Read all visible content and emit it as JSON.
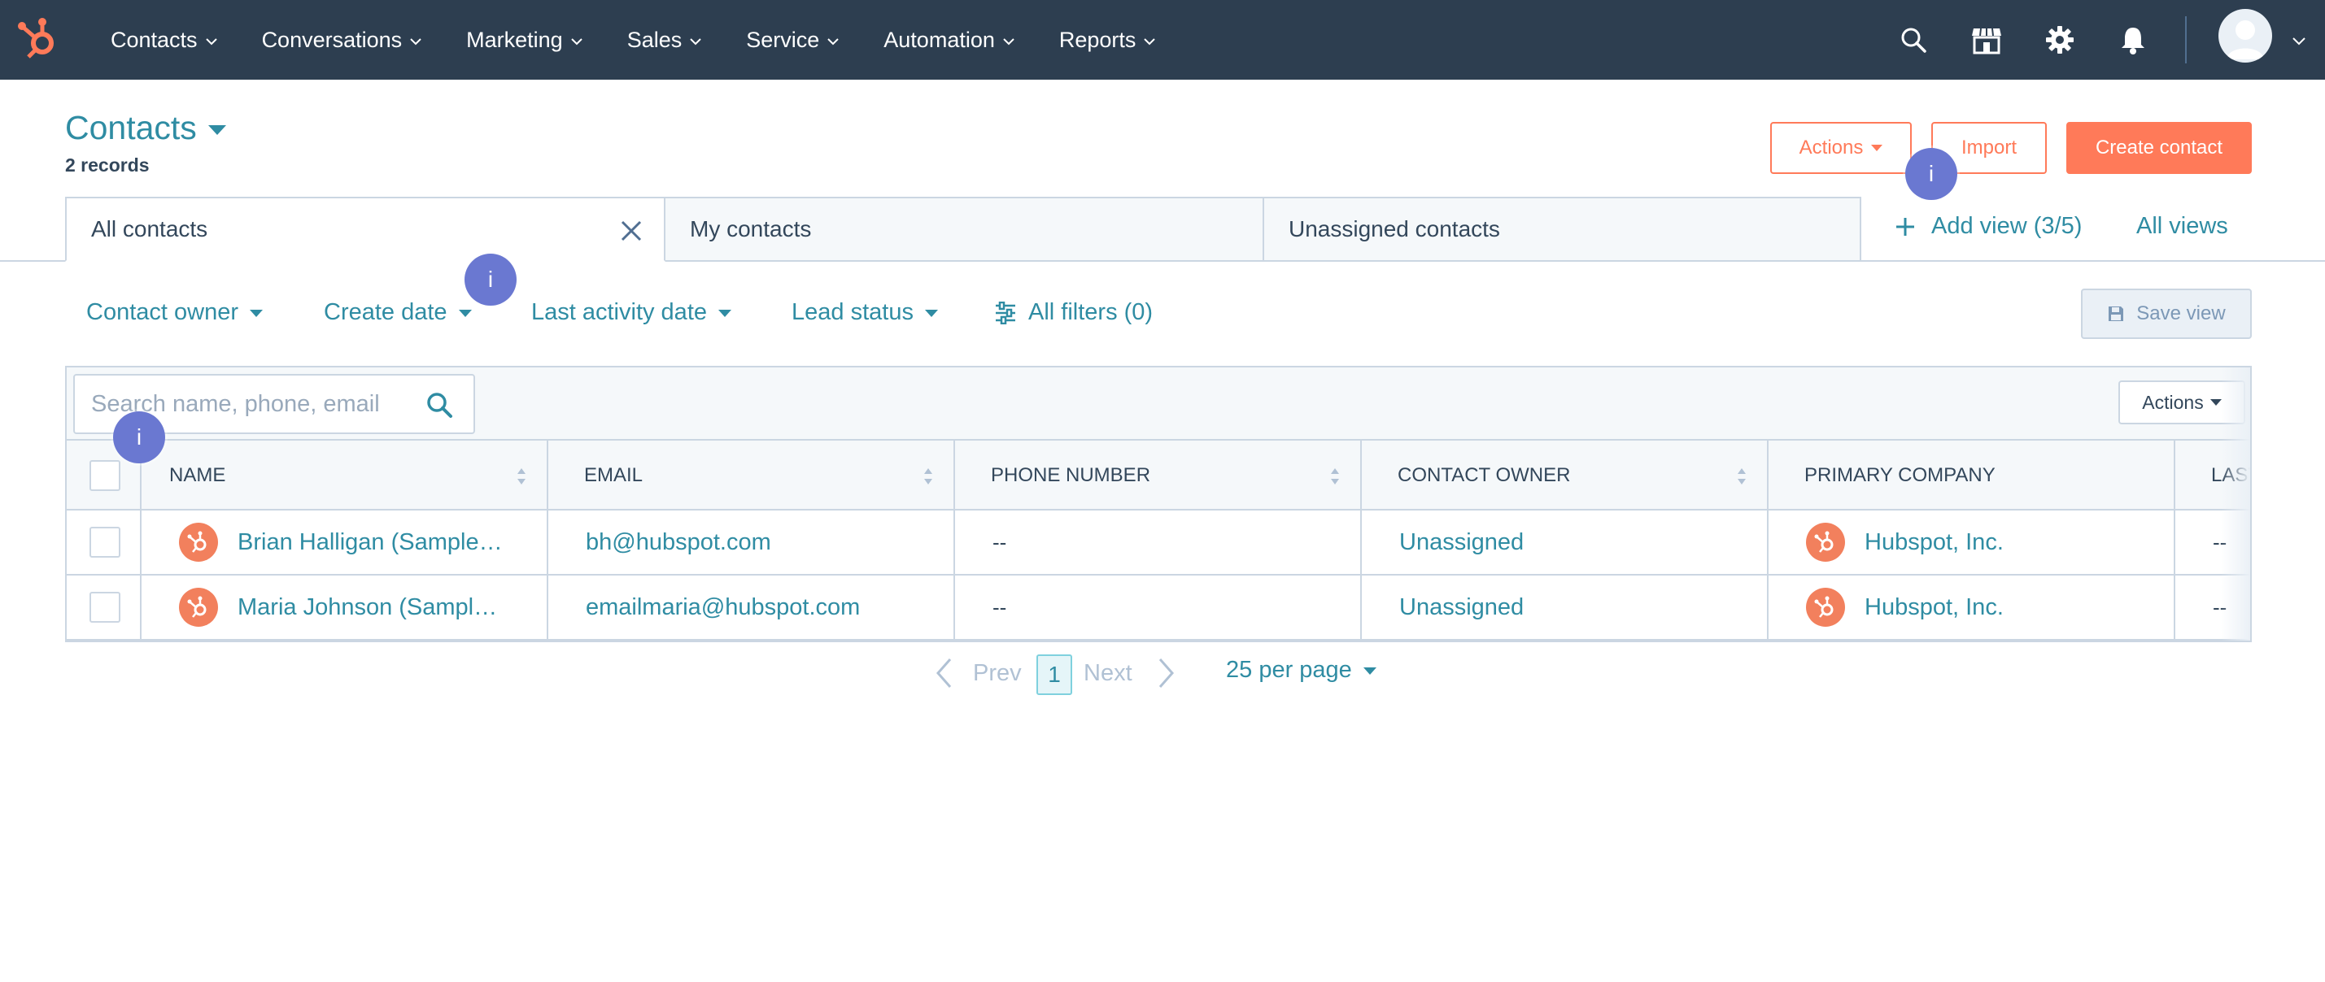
{
  "nav": {
    "items": [
      {
        "label": "Contacts"
      },
      {
        "label": "Conversations"
      },
      {
        "label": "Marketing"
      },
      {
        "label": "Sales"
      },
      {
        "label": "Service"
      },
      {
        "label": "Automation"
      },
      {
        "label": "Reports"
      }
    ],
    "icons": [
      "search-icon",
      "marketplace-icon",
      "settings-icon",
      "notifications-icon",
      "avatar"
    ]
  },
  "header": {
    "title": "Contacts",
    "records": "2 records",
    "actions_label": "Actions",
    "import_label": "Import",
    "create_label": "Create contact"
  },
  "views": {
    "tabs": [
      {
        "label": "All contacts",
        "active": true
      },
      {
        "label": "My contacts",
        "active": false
      },
      {
        "label": "Unassigned contacts",
        "active": false
      }
    ],
    "add_view": "Add view (3/5)",
    "all_views": "All views"
  },
  "filters": {
    "items": [
      {
        "label": "Contact owner"
      },
      {
        "label": "Create date"
      },
      {
        "label": "Last activity date"
      },
      {
        "label": "Lead status"
      }
    ],
    "all_filters": "All filters (0)",
    "save_view": "Save view"
  },
  "table": {
    "search_placeholder": "Search name, phone, email",
    "actions_label": "Actions",
    "columns": [
      "NAME",
      "EMAIL",
      "PHONE NUMBER",
      "CONTACT OWNER",
      "PRIMARY COMPANY",
      "LAST"
    ],
    "rows": [
      {
        "name": "Brian Halligan (Sample Contact)",
        "email": "bh@hubspot.com",
        "phone": "--",
        "owner": "Unassigned",
        "company": "Hubspot, Inc.",
        "last": "--"
      },
      {
        "name": "Maria Johnson (Sample Contact)",
        "email": "emailmaria@hubspot.com",
        "phone": "--",
        "owner": "Unassigned",
        "company": "Hubspot, Inc.",
        "last": "--"
      }
    ]
  },
  "pagination": {
    "prev": "Prev",
    "page": "1",
    "next": "Next",
    "per_page": "25 per page"
  },
  "beacons": {
    "label": "i"
  },
  "colors": {
    "nav_bg": "#2d3e50",
    "accent": "#ff7a59",
    "link": "#2f8ca3",
    "beacon": "#6a78d1"
  }
}
